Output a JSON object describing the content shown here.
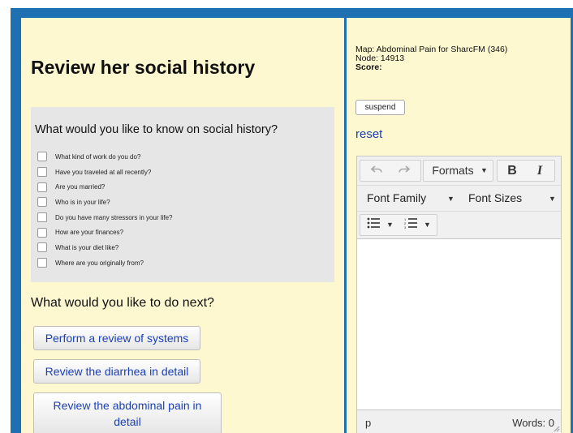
{
  "left": {
    "title": "Review her social history",
    "question": {
      "title": "What would you like to know on social history?",
      "options": [
        "What kind of work do you do?",
        "Have you traveled at all recently?",
        "Are you married?",
        "Who is in your life?",
        "Do you have many stressors in your life?",
        "How are your finances?",
        "What is your diet like?",
        "Where are you originally from?"
      ]
    },
    "next": {
      "title": "What would you like to do next?",
      "buttons": [
        "Perform a review of systems",
        "Review the diarrhea in detail",
        "Review the abdominal pain in detail"
      ]
    }
  },
  "right": {
    "map": "Map: Abdominal Pain for SharcFM (346)",
    "node": "Node: 14913",
    "score_label": "Score:",
    "suspend_label": "suspend",
    "reset_label": "reset",
    "editor": {
      "formats_label": "Formats",
      "bold_label": "B",
      "italic_label": "I",
      "font_family_label": "Font Family",
      "font_sizes_label": "Font Sizes",
      "status_path": "p",
      "word_count": "Words: 0",
      "icons": [
        "undo-icon",
        "redo-icon",
        "bullet-list-icon",
        "numbered-list-icon"
      ]
    }
  },
  "colors": {
    "frame": "#1f6fb3",
    "pane_background": "#fdf8d0",
    "link": "#1a3fb5"
  }
}
